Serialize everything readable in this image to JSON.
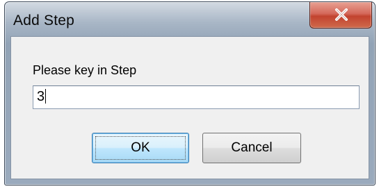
{
  "dialog": {
    "title": "Add Step",
    "close_icon": "close-icon",
    "prompt": "Please key in Step",
    "input_value": "3",
    "ok_label": "OK",
    "cancel_label": "Cancel"
  },
  "colors": {
    "close_button": "#c7472f",
    "default_button_border": "#3c7fb1",
    "client_background": "#f0f0f0"
  }
}
